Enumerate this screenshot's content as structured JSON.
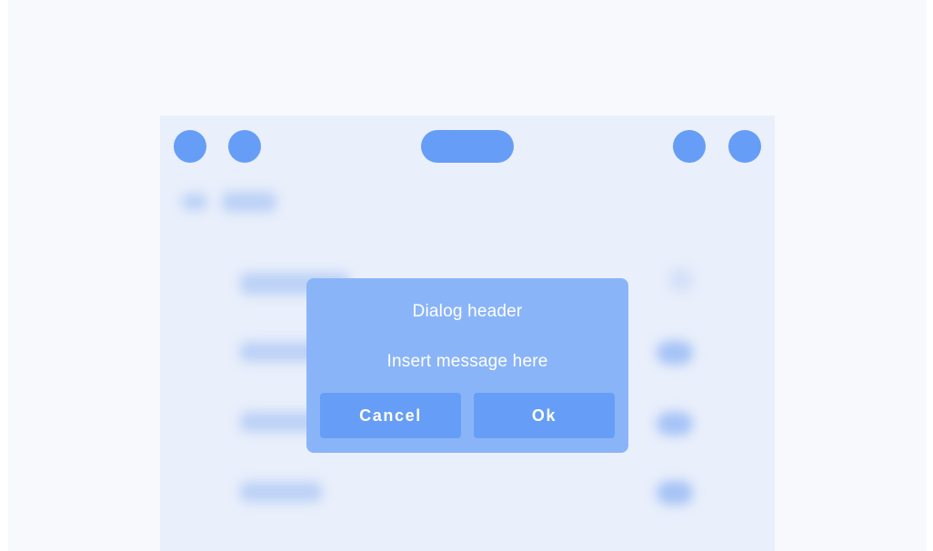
{
  "dialog": {
    "header": "Dialog header",
    "message": "Insert message here",
    "cancel_label": "Cancel",
    "ok_label": "Ok"
  },
  "colors": {
    "accent": "#669df6",
    "dialog_background": "#8ab4f8",
    "device_background": "#e9effb",
    "page_background": "#f7f9fc"
  }
}
